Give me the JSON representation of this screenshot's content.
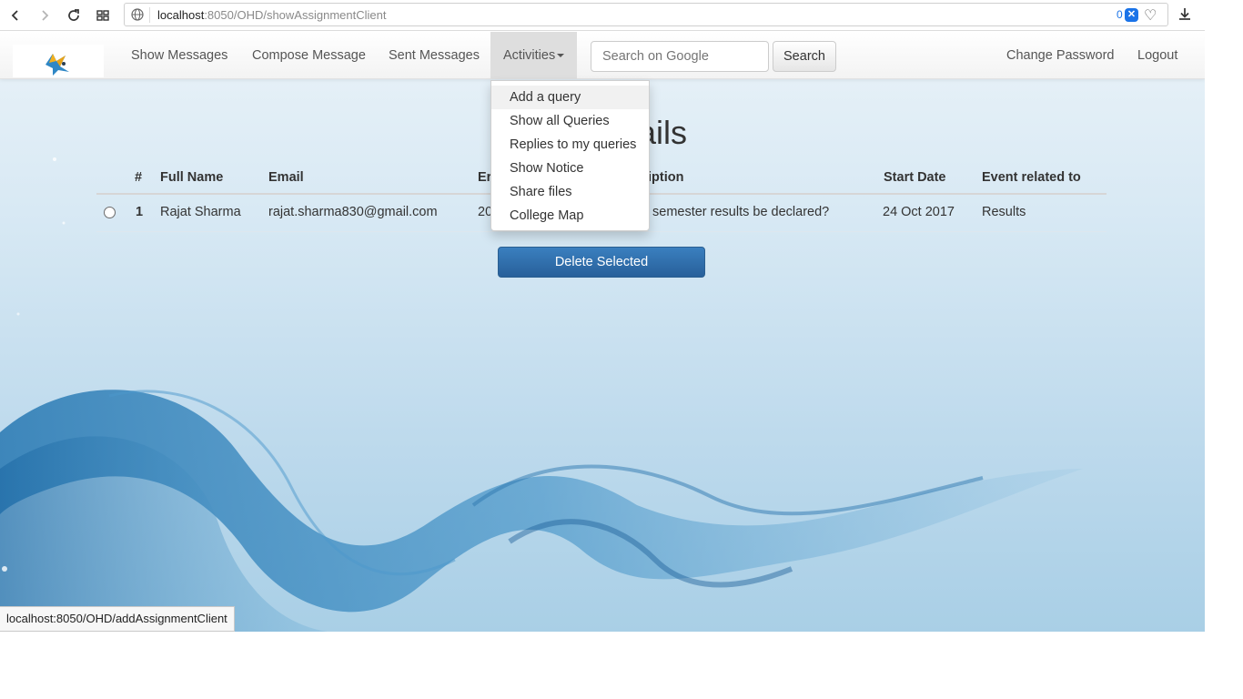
{
  "browser": {
    "url_host": "localhost",
    "url_rest": ":8050/OHD/showAssignmentClient",
    "tracker_count": "0"
  },
  "navbar": {
    "links": [
      "Show Messages",
      "Compose Message",
      "Sent Messages"
    ],
    "activities_label": "Activities",
    "search_placeholder": "Search on Google",
    "search_button": "Search",
    "change_password": "Change Password",
    "logout": "Logout"
  },
  "dropdown": {
    "items": [
      "Add a query",
      "Show all Queries",
      "Replies to my queries",
      "Show Notice",
      "Share files",
      "College Map"
    ]
  },
  "page": {
    "title_visible": "ails"
  },
  "table": {
    "headers": {
      "num": "#",
      "full_name": "Full Name",
      "email": "Email",
      "third": "Er",
      "description": "iption",
      "start_date": "Start Date",
      "event_related": "Event related to"
    },
    "rows": [
      {
        "num": "1",
        "full_name": "Rajat Sharma",
        "email": "rajat.sharma830@gmail.com",
        "third": "20",
        "description": "semester results be declared?",
        "start_date": "24 Oct 2017",
        "event_related": "Results"
      }
    ]
  },
  "delete_button": "Delete Selected",
  "status_bar": "localhost:8050/OHD/addAssignmentClient",
  "colors": {
    "primary_button": "#3071a9",
    "navbar_active": "#dedede",
    "browser_accent": "#1a73e8"
  }
}
